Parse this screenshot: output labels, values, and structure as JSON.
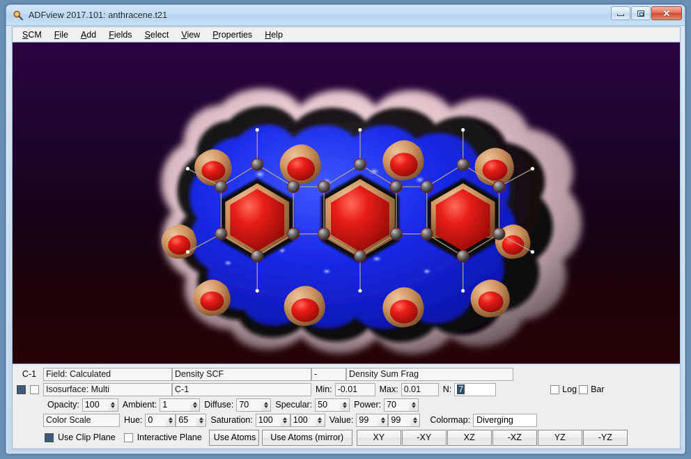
{
  "window": {
    "title": "ADFview 2017.101: anthracene.t21",
    "icon": "magnifier-icon",
    "controls": {
      "minimize": "minimize-icon",
      "restore": "restore-icon",
      "close": "close-icon"
    }
  },
  "menubar": {
    "items": [
      {
        "label": "SCM",
        "mnemonic": "S"
      },
      {
        "label": "File",
        "mnemonic": "F"
      },
      {
        "label": "Add",
        "mnemonic": "A"
      },
      {
        "label": "Fields",
        "mnemonic": "F"
      },
      {
        "label": "Select",
        "mnemonic": "S"
      },
      {
        "label": "View",
        "mnemonic": "V"
      },
      {
        "label": "Properties",
        "mnemonic": "P"
      },
      {
        "label": "Help",
        "mnemonic": "H"
      }
    ]
  },
  "viewport": {
    "background_top": "#2a0340",
    "background_bottom": "#260305",
    "molecule": "anthracene",
    "surface_colors": {
      "outer_shell": "#e7c9cf",
      "mid_shell": "#1a1214",
      "inner_blue": "#1428e6",
      "core_red": "#d81414",
      "rim_tan": "#cf9060",
      "atom_sphere": "#6b6b6b",
      "bond_line": "#b9a98c",
      "hydrogen_dot": "#ffffff"
    }
  },
  "panel": {
    "row1": {
      "cell_name": "C-1",
      "field_label": "Field: Calculated",
      "field_value": "Density SCF",
      "dash": "-",
      "field_value2": "Density Sum Frag"
    },
    "row2": {
      "checkbox_filled": true,
      "checkbox_empty": false,
      "isosurface_label": "Isosurface: Multi",
      "isosurface_value": "C-1",
      "min_label": "Min:",
      "min_value": "-0.01",
      "max_label": "Max:",
      "max_value": "0.01",
      "n_label": "N:",
      "n_value": "7",
      "log_label": "Log",
      "log_checked": false,
      "bar_label": "Bar",
      "bar_checked": false
    },
    "row3": {
      "opacity_label": "Opacity:",
      "opacity_value": "100",
      "ambient_label": "Ambient:",
      "ambient_value": "1",
      "diffuse_label": "Diffuse:",
      "diffuse_value": "70",
      "specular_label": "Specular:",
      "specular_value": "50",
      "power_label": "Power:",
      "power_value": "70"
    },
    "row4": {
      "color_scale_label": "Color Scale",
      "hue_label": "Hue:",
      "hue_value1": "0",
      "hue_value2": "65",
      "saturation_label": "Saturation:",
      "saturation_value1": "100",
      "saturation_value2": "100",
      "value_label": "Value:",
      "value_value1": "99",
      "value_value2": "99",
      "colormap_label": "Colormap:",
      "colormap_value": "Diverging"
    },
    "row5": {
      "use_clip_plane_label": "Use Clip Plane",
      "use_clip_plane_checked": true,
      "interactive_plane_label": "Interactive Plane",
      "interactive_plane_checked": false,
      "use_atoms_label": "Use Atoms",
      "use_atoms_mirror_label": "Use Atoms (mirror)",
      "plane_buttons": [
        "XY",
        "-XY",
        "XZ",
        "-XZ",
        "YZ",
        "-YZ"
      ]
    }
  }
}
